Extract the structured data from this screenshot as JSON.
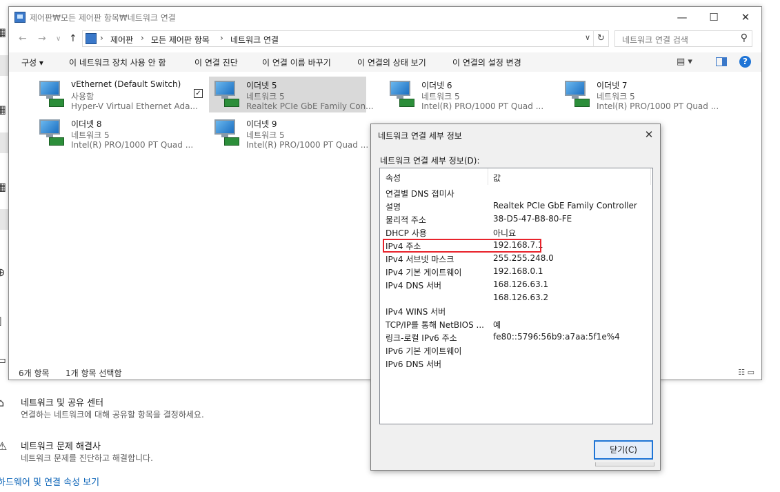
{
  "background": {
    "sharing_center": {
      "title": "네트워크 및 공유 센터",
      "subtitle": "연결하는 네트워크에 대해 공유할 항목을 결정하세요."
    },
    "troubleshooter": {
      "title": "네트워크 문제 해결사",
      "subtitle": "네트워크 문제를 진단하고 해결합니다."
    },
    "hardware_link": "하드웨어 및 연결 속성 보기"
  },
  "window": {
    "title": "제어판₩모든 제어판 항목₩네트워크 연결",
    "controls": {
      "minimize": "—",
      "maximize": "☐",
      "close": "✕"
    },
    "nav": {
      "back": "←",
      "forward": "→",
      "recent": "∨",
      "up": "↑"
    },
    "breadcrumb": [
      "제어판",
      "모든 제어판 항목",
      "네트워크 연결"
    ],
    "breadcrumb_sep": "›",
    "address_dropdown": "∨",
    "refresh": "↻",
    "search_placeholder": "네트워크 연결 검색",
    "search_icon": "⚲"
  },
  "commands": {
    "organize": "구성 ▾",
    "disable": "이 네트워크 장치 사용 안 함",
    "diagnose": "이 연결 진단",
    "rename": "이 연결 이름 바꾸기",
    "status": "이 연결의 상태 보기",
    "settings": "이 연결의 설정 변경",
    "view_options": "▤ ▾",
    "help": "?"
  },
  "connections": [
    {
      "name": "vEthernet (Default Switch)",
      "status": "사용함",
      "device": "Hyper-V Virtual Ethernet Ada..."
    },
    {
      "name": "이더넷 5",
      "status": "네트워크 5",
      "device": "Realtek PCIe GbE Family Con...",
      "selected": true,
      "checkmark": "✓"
    },
    {
      "name": "이더넷 6",
      "status": "네트워크 5",
      "device": "Intel(R) PRO/1000 PT Quad ..."
    },
    {
      "name": "이더넷 7",
      "status": "네트워크 5",
      "device": "Intel(R) PRO/1000 PT Quad ..."
    },
    {
      "name": "이더넷 8",
      "status": "네트워크 5",
      "device": "Intel(R) PRO/1000 PT Quad ..."
    },
    {
      "name": "이더넷 9",
      "status": "네트워크 5",
      "device": "Intel(R) PRO/1000 PT Quad ..."
    }
  ],
  "statusbar": {
    "item_count": "6개 항목",
    "selected_count": "1개 항목 선택함",
    "view_icons": "☷ ▭"
  },
  "dialog": {
    "title": "네트워크 연결 세부 정보",
    "close_x": "✕",
    "label": "네트워크 연결 세부 정보(D):",
    "columns": {
      "property": "속성",
      "value": "값"
    },
    "rows": [
      {
        "k": "연결별 DNS 접미사",
        "v": ""
      },
      {
        "k": "설명",
        "v": "Realtek PCIe GbE Family Controller"
      },
      {
        "k": "물리적 주소",
        "v": "38-D5-47-B8-80-FE"
      },
      {
        "k": "DHCP 사용",
        "v": "아니요"
      },
      {
        "k": "IPv4 주소",
        "v": "192.168.7.1"
      },
      {
        "k": "IPv4 서브넷 마스크",
        "v": "255.255.248.0"
      },
      {
        "k": "IPv4 기본 게이트웨이",
        "v": "192.168.0.1"
      },
      {
        "k": "IPv4 DNS 서버",
        "v": "168.126.63.1"
      },
      {
        "k": "",
        "v": "168.126.63.2"
      },
      {
        "k": "IPv4 WINS 서버",
        "v": ""
      },
      {
        "k": "TCP/IP를 통해 NetBIOS ...",
        "v": "예"
      },
      {
        "k": "링크-로컬 IPv6 주소",
        "v": "fe80::5796:56b9:a7aa:5f1e%4"
      },
      {
        "k": "IPv6 기본 게이트웨이",
        "v": ""
      },
      {
        "k": "IPv6 DNS 서버",
        "v": ""
      }
    ],
    "close_button": "닫기(C)"
  }
}
